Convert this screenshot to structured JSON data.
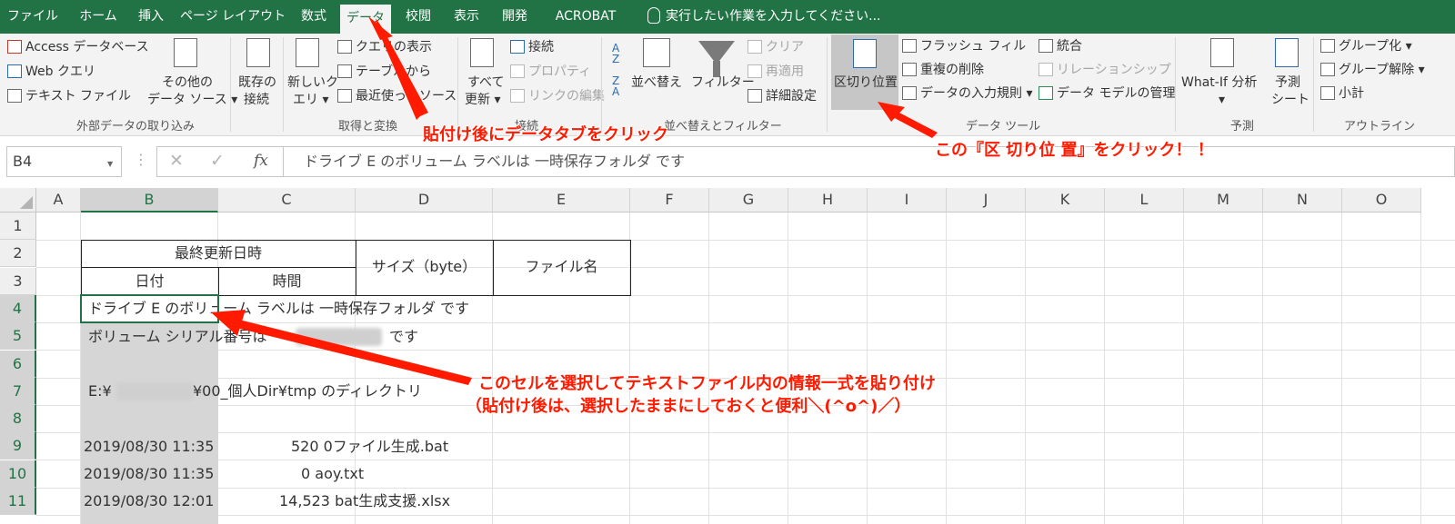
{
  "tabs": [
    "ファイル",
    "ホーム",
    "挿入",
    "ページ レイアウト",
    "数式",
    "データ",
    "校閲",
    "表示",
    "開発",
    "ACROBAT"
  ],
  "active_tab": "データ",
  "tell_me": "実行したい作業を入力してください...",
  "ribbon": {
    "external": {
      "access": "Access データベース",
      "web": "Web クエリ",
      "text": "テキスト ファイル",
      "other1": "その他の",
      "other2": "データ ソース ▾",
      "label": "外部データの取り込み"
    },
    "existing": {
      "l1": "既存の",
      "l2": "接続"
    },
    "transform": {
      "newq1": "新しいク",
      "newq2": "エリ ▾",
      "show_query": "クエリの表示",
      "from_table": "テーブルから",
      "recent": "最近使ったソース",
      "label": "取得と変換"
    },
    "connections": {
      "refresh1": "すべて",
      "refresh2": "更新 ▾",
      "conn": "接続",
      "props": "プロパティ",
      "edit_links": "リンクの編集",
      "label": "接続"
    },
    "sortfilter": {
      "sort": "並べ替え",
      "filter": "フィルター",
      "clear": "クリア",
      "reapply": "再適用",
      "advanced": "詳細設定",
      "label": "並べ替えとフィルター"
    },
    "datatools": {
      "split": "区切り位置",
      "flash": "フラッシュ フィル",
      "dedupe": "重複の削除",
      "validation": "データの入力規則 ▾",
      "consolidate": "統合",
      "relationships": "リレーションシップ",
      "model": "データ モデルの管理",
      "label": "データ ツール"
    },
    "forecast": {
      "whatif1": "What-If 分析",
      "whatif2": "▾",
      "sheet1": "予測",
      "sheet2": "シート",
      "label": "予測"
    },
    "outline": {
      "group": "グループ化 ▾",
      "ungroup": "グループ解除 ▾",
      "subtotal": "小計",
      "label": "アウトライン"
    }
  },
  "formula_bar": {
    "name_box": "B4",
    "cancel": "✕",
    "enter": "✓",
    "fx": "fx",
    "content": "ドライブ E のボリューム ラベルは 一時保存フォルダ です"
  },
  "columns": [
    "A",
    "B",
    "C",
    "D",
    "E",
    "F",
    "G",
    "H",
    "I",
    "J",
    "K",
    "L",
    "M",
    "N",
    "O"
  ],
  "rows": [
    "1",
    "2",
    "3",
    "4",
    "5",
    "6",
    "7",
    "8",
    "9",
    "10",
    "11"
  ],
  "cells": {
    "B2": "最終更新日時",
    "B3": "日付",
    "C3": "時間",
    "D2": "サイズ（byte）",
    "E2": "ファイル名",
    "B4": "ドライブ E のボリューム ラベルは 一時保存フォルダ です",
    "B5a": "ボリューム シリアル番号は",
    "B5b": "です",
    "B7a": "E:¥",
    "B7b": "¥00_個人Dir¥tmp のディレクトリ",
    "B9": "2019/08/30  11:35",
    "C9": "520 0ファイル生成.bat",
    "B10": "2019/08/30  11:35",
    "C10": "0 aoy.txt",
    "B11": "2019/08/30  12:01",
    "C11": "14,523 bat生成支援.xlsx"
  },
  "annotations": {
    "a1": "貼付け後にデータタブをクリック",
    "a2": "この『区 切り位 置』をクリック！ ！",
    "a3": "このセルを選択してテキストファイル内の情報一式を貼り付け",
    "a4": "（貼付け後は、選択したままにしておくと便利＼(^o^)／）"
  }
}
